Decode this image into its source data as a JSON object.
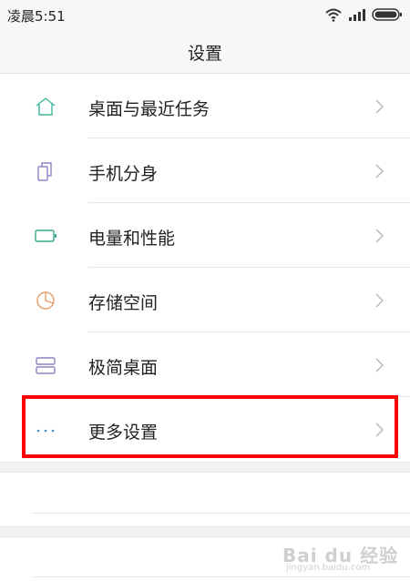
{
  "status_bar": {
    "time": "凌晨5:51",
    "icons": [
      "wifi-icon",
      "signal-icon",
      "battery-icon"
    ]
  },
  "header": {
    "title": "设置"
  },
  "items": [
    {
      "label": "桌面与最近任务",
      "icon": "home-icon",
      "icon_color": "#3cb89b"
    },
    {
      "label": "手机分身",
      "icon": "dual-app-icon",
      "icon_color": "#8a86c8"
    },
    {
      "label": "电量和性能",
      "icon": "battery-outline-icon",
      "icon_color": "#3aa88c"
    },
    {
      "label": "存储空间",
      "icon": "pie-chart-icon",
      "icon_color": "#e49a6a"
    },
    {
      "label": "极简桌面",
      "icon": "simple-desktop-icon",
      "icon_color": "#8a86c8"
    },
    {
      "label": "更多设置",
      "icon": "more-icon",
      "icon_color": "#3f8fd6",
      "highlighted": true
    }
  ],
  "highlight_color": "#ff0000",
  "watermark": {
    "text": "Bai du 经验",
    "subtext": "jingyan.baidu.com"
  }
}
